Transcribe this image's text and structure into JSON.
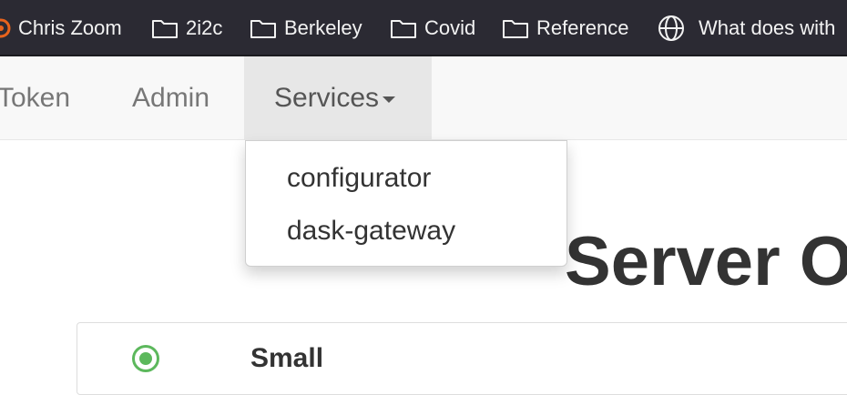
{
  "bookmarks": [
    {
      "label": "Chris Zoom",
      "icon": "zoom-icon"
    },
    {
      "label": "2i2c",
      "icon": "folder-icon"
    },
    {
      "label": "Berkeley",
      "icon": "folder-icon"
    },
    {
      "label": "Covid",
      "icon": "folder-icon"
    },
    {
      "label": "Reference",
      "icon": "folder-icon"
    },
    {
      "label": "What does with",
      "icon": "globe-icon"
    }
  ],
  "navbar": {
    "items": [
      {
        "label": "Token"
      },
      {
        "label": "Admin"
      },
      {
        "label": "Services",
        "active": true
      }
    ]
  },
  "services_dropdown": {
    "items": [
      "configurator",
      "dask-gateway"
    ]
  },
  "page": {
    "title": "Server O"
  },
  "profile": {
    "name": "Small",
    "selected": true
  },
  "colors": {
    "bookmark_bar": "#2b2a33",
    "navbar": "#f8f8f8",
    "accent_green": "#5cb85c",
    "zoom_orange": "#e8631c"
  }
}
